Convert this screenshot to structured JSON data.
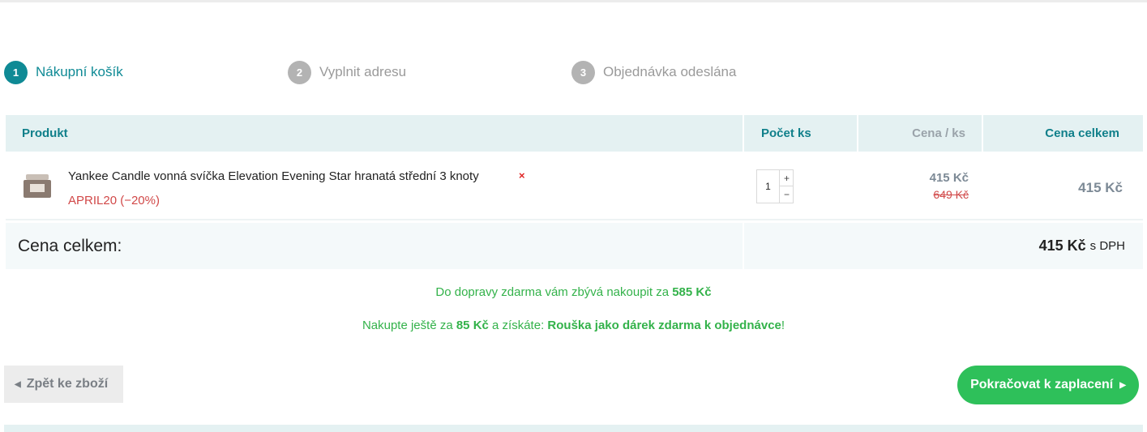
{
  "steps": [
    {
      "number": "1",
      "label": "Nákupní košík",
      "state": "active"
    },
    {
      "number": "2",
      "label": "Vyplnit adresu",
      "state": "inactive"
    },
    {
      "number": "3",
      "label": "Objednávka odeslána",
      "state": "inactive"
    }
  ],
  "table": {
    "headers": {
      "product": "Produkt",
      "quantity": "Počet ks",
      "unit_price": "Cena / ks",
      "total_price": "Cena celkem"
    },
    "items": [
      {
        "name": "Yankee Candle vonná svíčka Elevation Evening Star hranatá střední 3 knoty",
        "remove_icon": "×",
        "coupon": "APRIL20 (−20%)",
        "quantity": "1",
        "qty_plus": "+",
        "qty_minus": "−",
        "unit_price": "415 Kč",
        "old_price": "649 Kč",
        "total": "415 Kč"
      }
    ],
    "total_label": "Cena celkem:",
    "total_amount": "415 Kč",
    "total_suffix": "s DPH"
  },
  "notices": {
    "shipping_prefix": "Do dopravy zdarma vám zbývá nakoupit za ",
    "shipping_amount": "585 Kč",
    "gift_prefix": "Nakupte ještě za ",
    "gift_amount": "85 Kč",
    "gift_middle": " a získáte: ",
    "gift_item": "Rouška jako dárek zdarma k objednávce",
    "gift_suffix": "!"
  },
  "buttons": {
    "back_label": "Zpět ke zboží",
    "back_arrow": "◀",
    "next_label": "Pokračovat k zaplacení",
    "next_arrow": "▶"
  },
  "colors": {
    "accent": "#0f8a95",
    "success": "#2ec05a",
    "danger": "#d14848"
  }
}
